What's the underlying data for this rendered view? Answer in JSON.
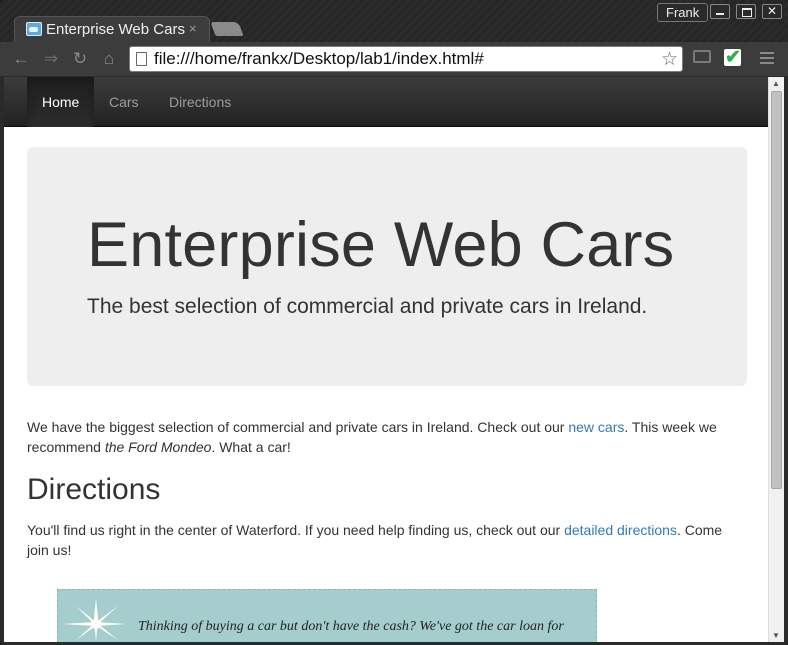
{
  "browser": {
    "tab_title": "Enterprise Web Cars",
    "tab_close": "×",
    "profile_name": "Frank",
    "url": "file:///home/frankx/Desktop/lab1/index.html#",
    "icons": [
      "back-icon",
      "forward-icon",
      "reload-icon",
      "home-icon",
      "page-icon",
      "star-icon",
      "cast-icon",
      "extension-check-icon",
      "menu-icon"
    ]
  },
  "site": {
    "nav": [
      "Home",
      "Cars",
      "Directions"
    ],
    "active_nav": "Home",
    "jumbotron": {
      "title": "Enterprise Web Cars",
      "lead": "The best selection of commercial and private cars in Ireland."
    },
    "intro": {
      "text1": "We have the biggest selection of commercial and private cars in Ireland. Check out our ",
      "link": "new cars",
      "text2": ". This week we recommend ",
      "emphasis": "the Ford Mondeo",
      "text3": ". What a car!"
    },
    "directions": {
      "heading": "Directions",
      "text1": "You'll find us right in the center of Waterford. If you need help finding us, check out our ",
      "link": "detailed directions",
      "text2": ". Come join us!"
    },
    "promo": {
      "text": "Thinking of buying a car but don't have the cash? We've got the car loan for"
    }
  },
  "colors": {
    "navbar": "#222222",
    "jumbotron": "#eeeeee",
    "link": "#337ab7",
    "promo": "#a6cdcd"
  }
}
